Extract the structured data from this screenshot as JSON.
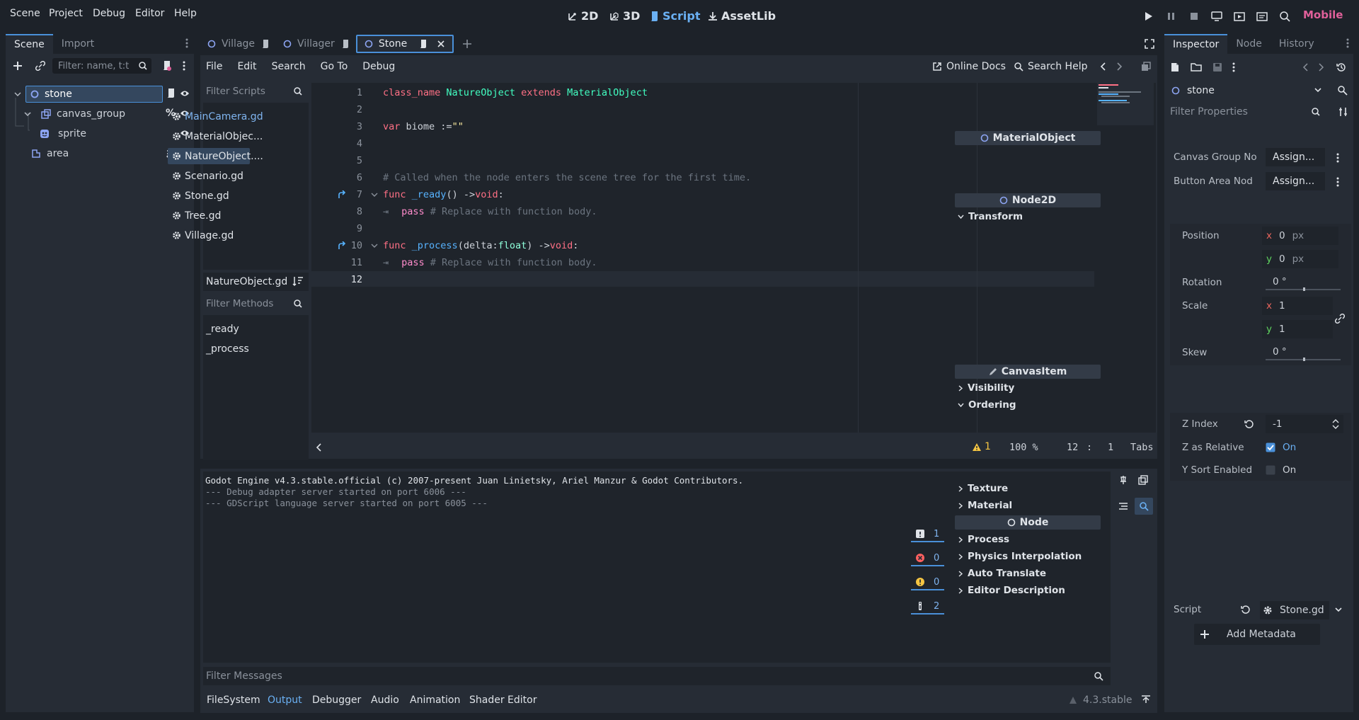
{
  "menu": {
    "scene": "Scene",
    "project": "Project",
    "debug": "Debug",
    "editor": "Editor",
    "help": "Help"
  },
  "workspaces": {
    "w2d": "2D",
    "w3d": "3D",
    "script": "Script",
    "assetlib": "AssetLib"
  },
  "renderer": "Mobile",
  "scene_dock": {
    "tab_scene": "Scene",
    "tab_import": "Import",
    "filter_placeholder": "Filter: name, t:t",
    "nodes": [
      {
        "name": "stone"
      },
      {
        "name": "canvas_group"
      },
      {
        "name": "sprite"
      },
      {
        "name": "area"
      }
    ]
  },
  "editor_tabs": [
    {
      "label": "Village"
    },
    {
      "label": "Villager"
    },
    {
      "label": "Stone"
    }
  ],
  "script_menu": {
    "file": "File",
    "edit": "Edit",
    "search": "Search",
    "goto": "Go To",
    "debug": "Debug",
    "online_docs": "Online Docs",
    "search_help": "Search Help"
  },
  "scripts_panel": {
    "filter_placeholder": "Filter Scripts",
    "items": [
      "MainCamera.gd",
      "MaterialObjec...",
      "NatureObject....",
      "Scenario.gd",
      "Stone.gd",
      "Tree.gd",
      "Village.gd"
    ],
    "current": "NatureObject.gd",
    "methods_placeholder": "Filter Methods",
    "methods": [
      "_ready",
      "_process"
    ]
  },
  "code": {
    "line_numbers": [
      "1",
      "2",
      "3",
      "4",
      "5",
      "6",
      "7",
      "8",
      "9",
      "10",
      "11",
      "12"
    ],
    "l1": {
      "a": "class_name",
      "b": "NatureObject",
      "c": "extends",
      "d": "MaterialObject"
    },
    "l3": {
      "a": "var",
      "b": "biome := ",
      "c": "\"\""
    },
    "l6": "# Called when the node enters the scene tree for the first time.",
    "l7": {
      "a": "func",
      "b": "_ready",
      "c": "() -> ",
      "d": "void",
      ":": ":"
    },
    "l8": {
      "a": "pass",
      "b": "# Replace with function body."
    },
    "l10": {
      "a": "func",
      "b": "_process",
      "c": "(delta: ",
      "d": "float",
      "e": ") -> ",
      "f": "void"
    },
    "l11": {
      "a": "pass",
      "b": "# Replace with function body."
    }
  },
  "status": {
    "warnings": "1",
    "zoom": "100 %",
    "line": "12",
    "sep": ":",
    "col": "1",
    "indent": "Tabs"
  },
  "output": {
    "lines": [
      "Godot Engine v4.3.stable.official (c) 2007-present Juan Linietsky, Ariel Manzur & Godot Contributors.",
      "--- Debug adapter server started on port 6006 ---",
      "--- GDScript language server started on port 6005 ---"
    ],
    "filter_placeholder": "Filter Messages",
    "counts": {
      "messages": "1",
      "errors": "0",
      "warnings": "0",
      "info": "2"
    }
  },
  "bottom_tabs": [
    "FileSystem",
    "Output",
    "Debugger",
    "Audio",
    "Animation",
    "Shader Editor"
  ],
  "version": "4.3.stable",
  "inspector": {
    "tabs": [
      "Inspector",
      "Node",
      "History"
    ],
    "object": "stone",
    "filter_placeholder": "Filter Properties",
    "material_object": "MaterialObject",
    "canvas_group_label": "Canvas Group No",
    "button_area_label": "Button Area Nod",
    "assign": "Assign...",
    "node2d": "Node2D",
    "transform": "Transform",
    "position": "Position",
    "pos_x": "0",
    "pos_y": "0",
    "px": "px",
    "rotation": "Rotation",
    "rotation_val": "0 °",
    "scale": "Scale",
    "scale_x": "1",
    "scale_y": "1",
    "skew": "Skew",
    "skew_val": "0 °",
    "x": "x",
    "y": "y",
    "canvas_item": "CanvasItem",
    "visibility": "Visibility",
    "ordering": "Ordering",
    "z_index": "Z Index",
    "z_index_val": "-1",
    "z_relative": "Z as Relative",
    "on": "On",
    "y_sort": "Y Sort Enabled",
    "texture": "Texture",
    "material": "Material",
    "node": "Node",
    "process": "Process",
    "physics_interp": "Physics Interpolation",
    "auto_translate": "Auto Translate",
    "editor_desc": "Editor Description",
    "script": "Script",
    "script_val": "Stone.gd",
    "add_metadata": "Add Metadata"
  },
  "colors": {
    "accent": "#4a90d9",
    "bg": "#1d2229",
    "panel": "#262c35"
  }
}
